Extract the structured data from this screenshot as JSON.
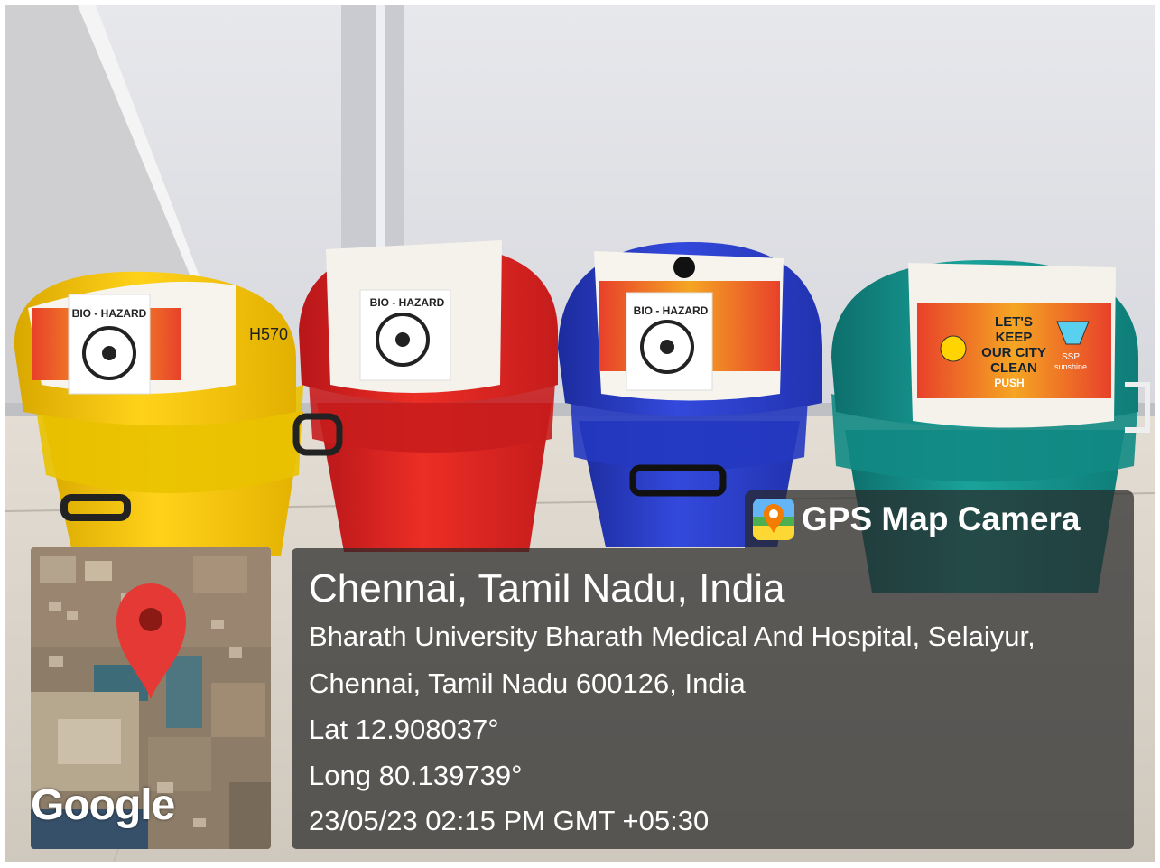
{
  "image": {
    "description_colors": {
      "yellow_bin": "#f2c300",
      "red_bin": "#e0261f",
      "blue_bin": "#2a3fc9",
      "teal_bin": "#16908a"
    }
  },
  "stickers": {
    "biohazard_label": "BIO - HAZARD",
    "clean_city": [
      "LET'S",
      "KEEP",
      "OUR CITY",
      "CLEAN"
    ],
    "push_label": "PUSH",
    "brand_label": "SSP",
    "brand_sub": "sunshine",
    "handwritten_code": "H570"
  },
  "overlay": {
    "app_title": "GPS Map Camera",
    "app_icon": "map-pin-icon",
    "map_logo": "Google",
    "city_line": "Chennai, Tamil Nadu, India",
    "address_line1": "Bharath University Bharath Medical And Hospital, Selaiyur,",
    "address_line2": "Chennai, Tamil Nadu 600126, India",
    "latitude": "Lat 12.908037°",
    "longitude": "Long 80.139739°",
    "timestamp": "23/05/23 02:15 PM GMT +05:30",
    "map_pin_color": "#e53935"
  }
}
